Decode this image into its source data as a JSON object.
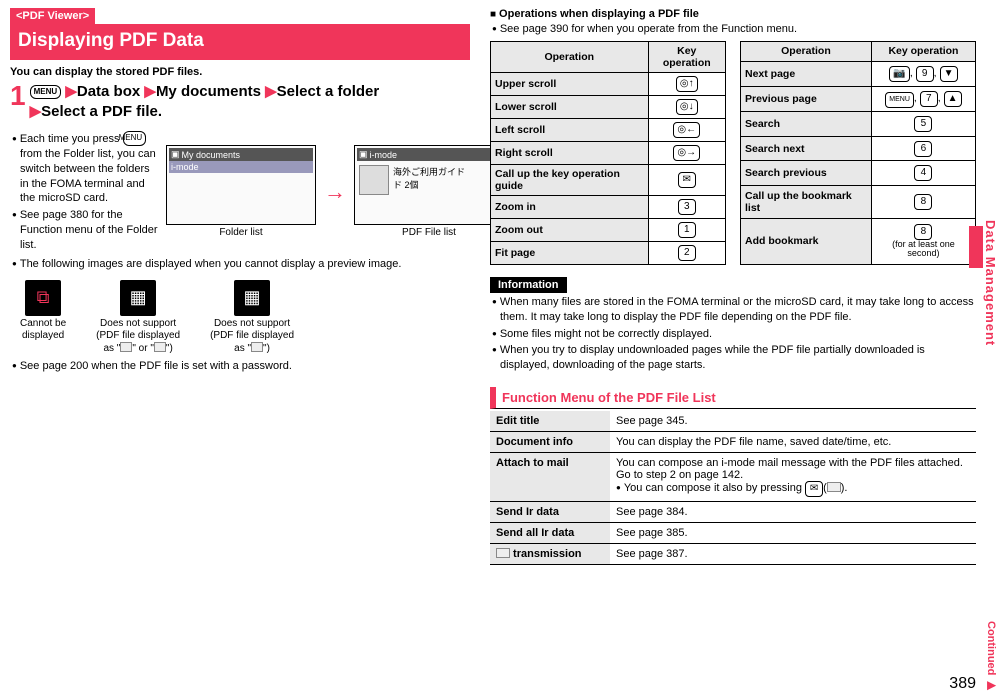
{
  "left": {
    "tag": "<PDF Viewer>",
    "title": "Displaying PDF Data",
    "intro": "You can display the stored PDF files.",
    "stepnum": "1",
    "menu_badge": "MENU",
    "step_parts": [
      "Data box",
      "My documents",
      "Select a folder",
      "Select a PDF file."
    ],
    "bullets_a": [
      "Each time you press",
      "from the Folder list, you can switch between the folders in the FOMA terminal and the microSD card.",
      "See page 380 for the Function menu of the Folder list."
    ],
    "folder_caption": "Folder list",
    "folder_header": "My documents",
    "folder_item": "i-mode",
    "pdf_caption": "PDF File list",
    "pdf_header": "i-mode",
    "pdf_item1": "海外ご利用ガイド",
    "pdf_item2": "ド 2個",
    "bullets_b": [
      "The following images are displayed when you cannot display a preview image."
    ],
    "thumbs": [
      {
        "label1": "Cannot be",
        "label2": "displayed",
        "ic": "NG"
      },
      {
        "label1": "Does not support",
        "label2": "(PDF file displayed",
        "label3": "as \"",
        "label4": "\" or \"",
        "label5": "\")"
      },
      {
        "label1": "Does not support",
        "label2": "(PDF file displayed",
        "label3": "as \"",
        "label4": "\")"
      }
    ],
    "bullets_c": [
      "See page 200 when the PDF file is set with a password."
    ]
  },
  "right": {
    "subheader": "Operations when displaying a PDF file",
    "subnote": "See page 390 for when you operate from the Function menu.",
    "th_op": "Operation",
    "th_key": "Key operation",
    "ops_left": [
      {
        "op": "Upper scroll",
        "key": "◎↑"
      },
      {
        "op": "Lower scroll",
        "key": "◎↓"
      },
      {
        "op": "Left scroll",
        "key": "◎←"
      },
      {
        "op": "Right scroll",
        "key": "◎→"
      },
      {
        "op": "Call up the key operation guide",
        "key": "✉"
      },
      {
        "op": "Zoom in",
        "key": "3"
      },
      {
        "op": "Zoom out",
        "key": "1"
      },
      {
        "op": "Fit page",
        "key": "2"
      }
    ],
    "ops_right": [
      {
        "op": "Next page",
        "key": "📷 , 9 , ▼"
      },
      {
        "op": "Previous page",
        "key": "MENU , 7 , ▲"
      },
      {
        "op": "Search",
        "key": "5"
      },
      {
        "op": "Search next",
        "key": "6"
      },
      {
        "op": "Search previous",
        "key": "4"
      },
      {
        "op": "Call up the bookmark list",
        "key": "8"
      },
      {
        "op": "Add bookmark",
        "key": "8",
        "note": "(for at least one second)"
      }
    ],
    "info_title": "Information",
    "info": [
      "When many files are stored in the FOMA terminal or the microSD card, it may take long to access them. It may take long to display the PDF file depending on the PDF file.",
      "Some files might not be correctly displayed.",
      "When you try to display undownloaded pages while the PDF file partially downloaded is displayed, downloading of the page starts."
    ],
    "fn_title": "Function Menu of the PDF File List",
    "fn_rows": [
      {
        "h": "Edit title",
        "d": "See page 345."
      },
      {
        "h": "Document info",
        "d": "You can display the PDF file name, saved date/time, etc."
      },
      {
        "h": "Attach to mail",
        "d": "You can compose an i-mode mail message with the PDF files attached.\nGo to step 2 on page 142.",
        "d2": "You can compose it also by pressing",
        "d3": "(",
        "d4": ")."
      },
      {
        "h": "Send Ir data",
        "d": "See page 384."
      },
      {
        "h": "Send all Ir data",
        "d": "See page 385."
      },
      {
        "h": " transmission",
        "ic": "1",
        "d": "See page 387."
      }
    ]
  },
  "side": "Data Management",
  "continued": "Continued",
  "pagenum": "389"
}
